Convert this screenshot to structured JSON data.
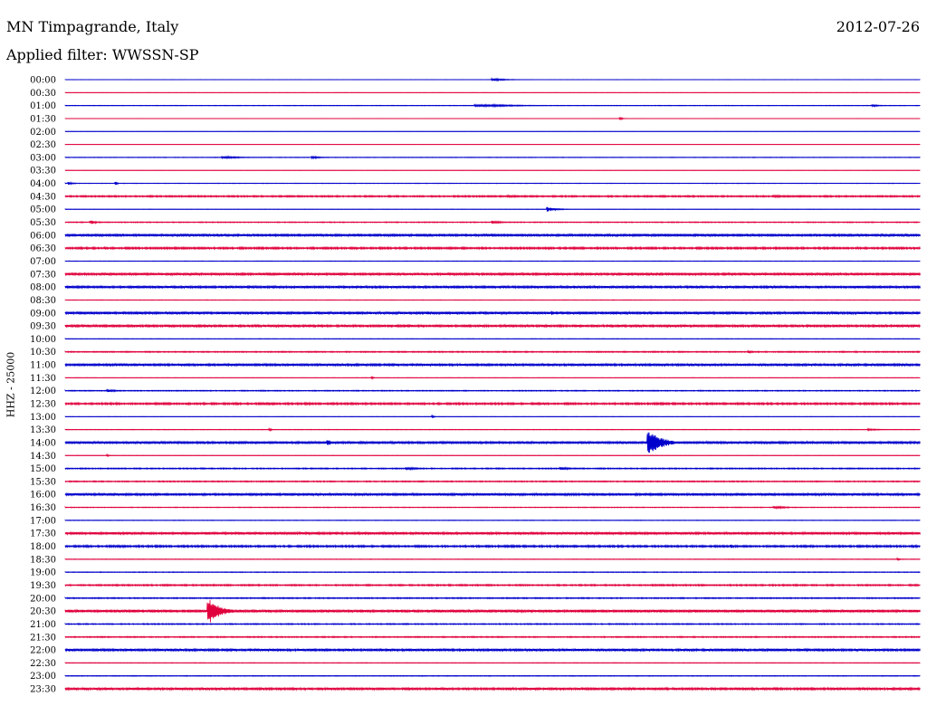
{
  "header": {
    "station": "MN Timpagrande, Italy",
    "date": "2012-07-26",
    "filter": "Applied filter: WWSSN-SP"
  },
  "axis": {
    "ylabel": "HHZ - 25000"
  },
  "colors": {
    "even_row": "#0000cc",
    "odd_row": "#e0003c"
  },
  "chart_data": {
    "type": "line",
    "title": "MN Timpagrande, Italy",
    "xlabel": "",
    "ylabel": "HHZ - 25000",
    "row_interval_minutes": 30,
    "x_range_minutes": [
      0,
      30
    ],
    "rows": [
      {
        "label": "00:00",
        "noise": 0.15,
        "events": [
          {
            "x": 0.5,
            "amp": 1.5,
            "dur": 0.04
          }
        ]
      },
      {
        "label": "00:30",
        "noise": 0.1,
        "events": []
      },
      {
        "label": "01:00",
        "noise": 0.3,
        "events": [
          {
            "x": 0.48,
            "amp": 1.5,
            "dur": 0.12
          },
          {
            "x": 0.945,
            "amp": 1.3,
            "dur": 0.02
          }
        ]
      },
      {
        "label": "01:30",
        "noise": 0.1,
        "events": [
          {
            "x": 0.65,
            "amp": 1.0,
            "dur": 0.01
          }
        ]
      },
      {
        "label": "02:00",
        "noise": 0.1,
        "events": []
      },
      {
        "label": "02:30",
        "noise": 0.1,
        "events": []
      },
      {
        "label": "03:00",
        "noise": 0.3,
        "events": [
          {
            "x": 0.185,
            "amp": 1.5,
            "dur": 0.05
          },
          {
            "x": 0.29,
            "amp": 1.2,
            "dur": 0.03
          }
        ]
      },
      {
        "label": "03:30",
        "noise": 0.1,
        "events": []
      },
      {
        "label": "04:00",
        "noise": 0.3,
        "events": [
          {
            "x": 0.005,
            "amp": 1.5,
            "dur": 0.015
          },
          {
            "x": 0.06,
            "amp": 1.5,
            "dur": 0.005
          }
        ]
      },
      {
        "label": "04:30",
        "noise": 0.8,
        "events": [
          {
            "x": 0.52,
            "amp": 1.2,
            "dur": 0.06
          },
          {
            "x": 0.83,
            "amp": 1.2,
            "dur": 0.06
          }
        ]
      },
      {
        "label": "05:00",
        "noise": 0.2,
        "events": [
          {
            "x": 0.565,
            "amp": 2.5,
            "dur": 0.025
          }
        ]
      },
      {
        "label": "05:30",
        "noise": 0.5,
        "events": [
          {
            "x": 0.03,
            "amp": 2.0,
            "dur": 0.02
          },
          {
            "x": 0.5,
            "amp": 1.5,
            "dur": 0.04
          }
        ]
      },
      {
        "label": "06:00",
        "noise": 1.5,
        "events": []
      },
      {
        "label": "06:30",
        "noise": 1.0,
        "events": []
      },
      {
        "label": "07:00",
        "noise": 0.3,
        "events": []
      },
      {
        "label": "07:30",
        "noise": 1.3,
        "events": []
      },
      {
        "label": "08:00",
        "noise": 1.3,
        "events": []
      },
      {
        "label": "08:30",
        "noise": 0.3,
        "events": []
      },
      {
        "label": "09:00",
        "noise": 1.4,
        "events": [
          {
            "x": 0.57,
            "amp": 2.5,
            "dur": 0.01
          }
        ]
      },
      {
        "label": "09:30",
        "noise": 1.2,
        "events": []
      },
      {
        "label": "10:00",
        "noise": 0.3,
        "events": []
      },
      {
        "label": "10:30",
        "noise": 0.6,
        "events": [
          {
            "x": 0.8,
            "amp": 1.3,
            "dur": 0.02
          }
        ]
      },
      {
        "label": "11:00",
        "noise": 1.3,
        "events": []
      },
      {
        "label": "11:30",
        "noise": 0.2,
        "events": [
          {
            "x": 0.36,
            "amp": 1.0,
            "dur": 0.005
          }
        ]
      },
      {
        "label": "12:00",
        "noise": 0.5,
        "events": [
          {
            "x": 0.05,
            "amp": 1.5,
            "dur": 0.03
          }
        ]
      },
      {
        "label": "12:30",
        "noise": 1.0,
        "events": []
      },
      {
        "label": "13:00",
        "noise": 0.2,
        "events": [
          {
            "x": 0.43,
            "amp": 1.5,
            "dur": 0.004
          }
        ]
      },
      {
        "label": "13:30",
        "noise": 0.3,
        "events": [
          {
            "x": 0.94,
            "amp": 1.0,
            "dur": 0.04
          },
          {
            "x": 0.24,
            "amp": 1.5,
            "dur": 0.004
          }
        ]
      },
      {
        "label": "14:00",
        "noise": 1.4,
        "events": [
          {
            "x": 0.308,
            "amp": 3.0,
            "dur": 0.015
          },
          {
            "x": 0.683,
            "amp": 16.0,
            "dur": 0.035
          }
        ]
      },
      {
        "label": "14:30",
        "noise": 0.2,
        "events": [
          {
            "x": 0.05,
            "amp": 1.2,
            "dur": 0.004
          }
        ]
      },
      {
        "label": "15:00",
        "noise": 0.6,
        "events": [
          {
            "x": 0.4,
            "amp": 1.5,
            "dur": 0.04
          },
          {
            "x": 0.58,
            "amp": 1.5,
            "dur": 0.05
          }
        ]
      },
      {
        "label": "15:30",
        "noise": 0.6,
        "events": []
      },
      {
        "label": "16:00",
        "noise": 1.3,
        "events": []
      },
      {
        "label": "16:30",
        "noise": 0.4,
        "events": [
          {
            "x": 0.83,
            "amp": 1.5,
            "dur": 0.04
          }
        ]
      },
      {
        "label": "17:00",
        "noise": 0.3,
        "events": []
      },
      {
        "label": "17:30",
        "noise": 1.3,
        "events": []
      },
      {
        "label": "18:00",
        "noise": 1.0,
        "events": [
          {
            "x": 0.78,
            "amp": 2.0,
            "dur": 0.01
          }
        ]
      },
      {
        "label": "18:30",
        "noise": 0.3,
        "events": [
          {
            "x": 0.975,
            "amp": 1.5,
            "dur": 0.005
          }
        ]
      },
      {
        "label": "19:00",
        "noise": 0.4,
        "events": []
      },
      {
        "label": "19:30",
        "noise": 0.8,
        "events": []
      },
      {
        "label": "20:00",
        "noise": 0.6,
        "events": []
      },
      {
        "label": "20:30",
        "noise": 1.5,
        "events": [
          {
            "x": 0.168,
            "amp": 16.0,
            "dur": 0.03
          }
        ]
      },
      {
        "label": "21:00",
        "noise": 0.6,
        "events": []
      },
      {
        "label": "21:30",
        "noise": 0.6,
        "events": []
      },
      {
        "label": "22:00",
        "noise": 1.3,
        "events": []
      },
      {
        "label": "22:30",
        "noise": 0.3,
        "events": []
      },
      {
        "label": "23:00",
        "noise": 0.4,
        "events": []
      },
      {
        "label": "23:30",
        "noise": 1.2,
        "events": []
      }
    ]
  }
}
